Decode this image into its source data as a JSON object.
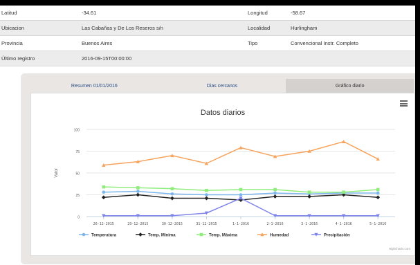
{
  "info": [
    {
      "label_left": "Latitud",
      "value_left": "-34.61",
      "label_right": "Longitud",
      "value_right": "-58.67"
    },
    {
      "label_left": "Ubicacion",
      "value_left": "Las Cabañas y De Los Reseros s/n",
      "label_right": "Localidad",
      "value_right": "Hurlingham"
    },
    {
      "label_left": "Provincia",
      "value_left": "Buenos Aires",
      "label_right": "Tipo",
      "value_right": "Convencional Instr. Completo"
    },
    {
      "label_left": "Último registro",
      "value_left": "2016-09-15T00:00:00",
      "label_right": "",
      "value_right": ""
    }
  ],
  "tabs": [
    {
      "label": "Resumen 01/01/2016",
      "active": false
    },
    {
      "label": "Dias cercanos",
      "active": false
    },
    {
      "label": "Gráfico diario",
      "active": true
    }
  ],
  "chart_data": {
    "type": "line",
    "title": "Datos diarios",
    "ylabel": "Valor",
    "xlabel": "",
    "ylim": [
      0,
      100
    ],
    "yticks": [
      0,
      25,
      50,
      75,
      100
    ],
    "categories": [
      "26-12-2015",
      "29-12-2015",
      "30-12-2015",
      "31-12-2015",
      "1-1-2016",
      "2-1-2016",
      "3-1-2016",
      "4-1-2016",
      "5-1-2016"
    ],
    "series": [
      {
        "name": "Temperatura",
        "color": "#7cb5ec",
        "marker": "circle",
        "values": [
          28,
          29,
          26,
          25,
          25,
          27,
          26,
          27,
          27
        ]
      },
      {
        "name": "Temp. Mínima",
        "color": "#222222",
        "marker": "diamond",
        "values": [
          22,
          25,
          21,
          21,
          19,
          23,
          23,
          25,
          22
        ]
      },
      {
        "name": "Temp. Máxima",
        "color": "#90ed7d",
        "marker": "square",
        "values": [
          34,
          33,
          32,
          30,
          31,
          31,
          28,
          28,
          31
        ]
      },
      {
        "name": "Humedad",
        "color": "#f7a35c",
        "marker": "triangle",
        "values": [
          59,
          63,
          70,
          61,
          79,
          69,
          75,
          86,
          66
        ]
      },
      {
        "name": "Precipitación",
        "color": "#8085e9",
        "marker": "triangle-down",
        "values": [
          1,
          1,
          1,
          4,
          21,
          1,
          1,
          1,
          1
        ]
      }
    ],
    "grid": true,
    "legend": "bottom-center",
    "credits": "Highcharts.com"
  }
}
